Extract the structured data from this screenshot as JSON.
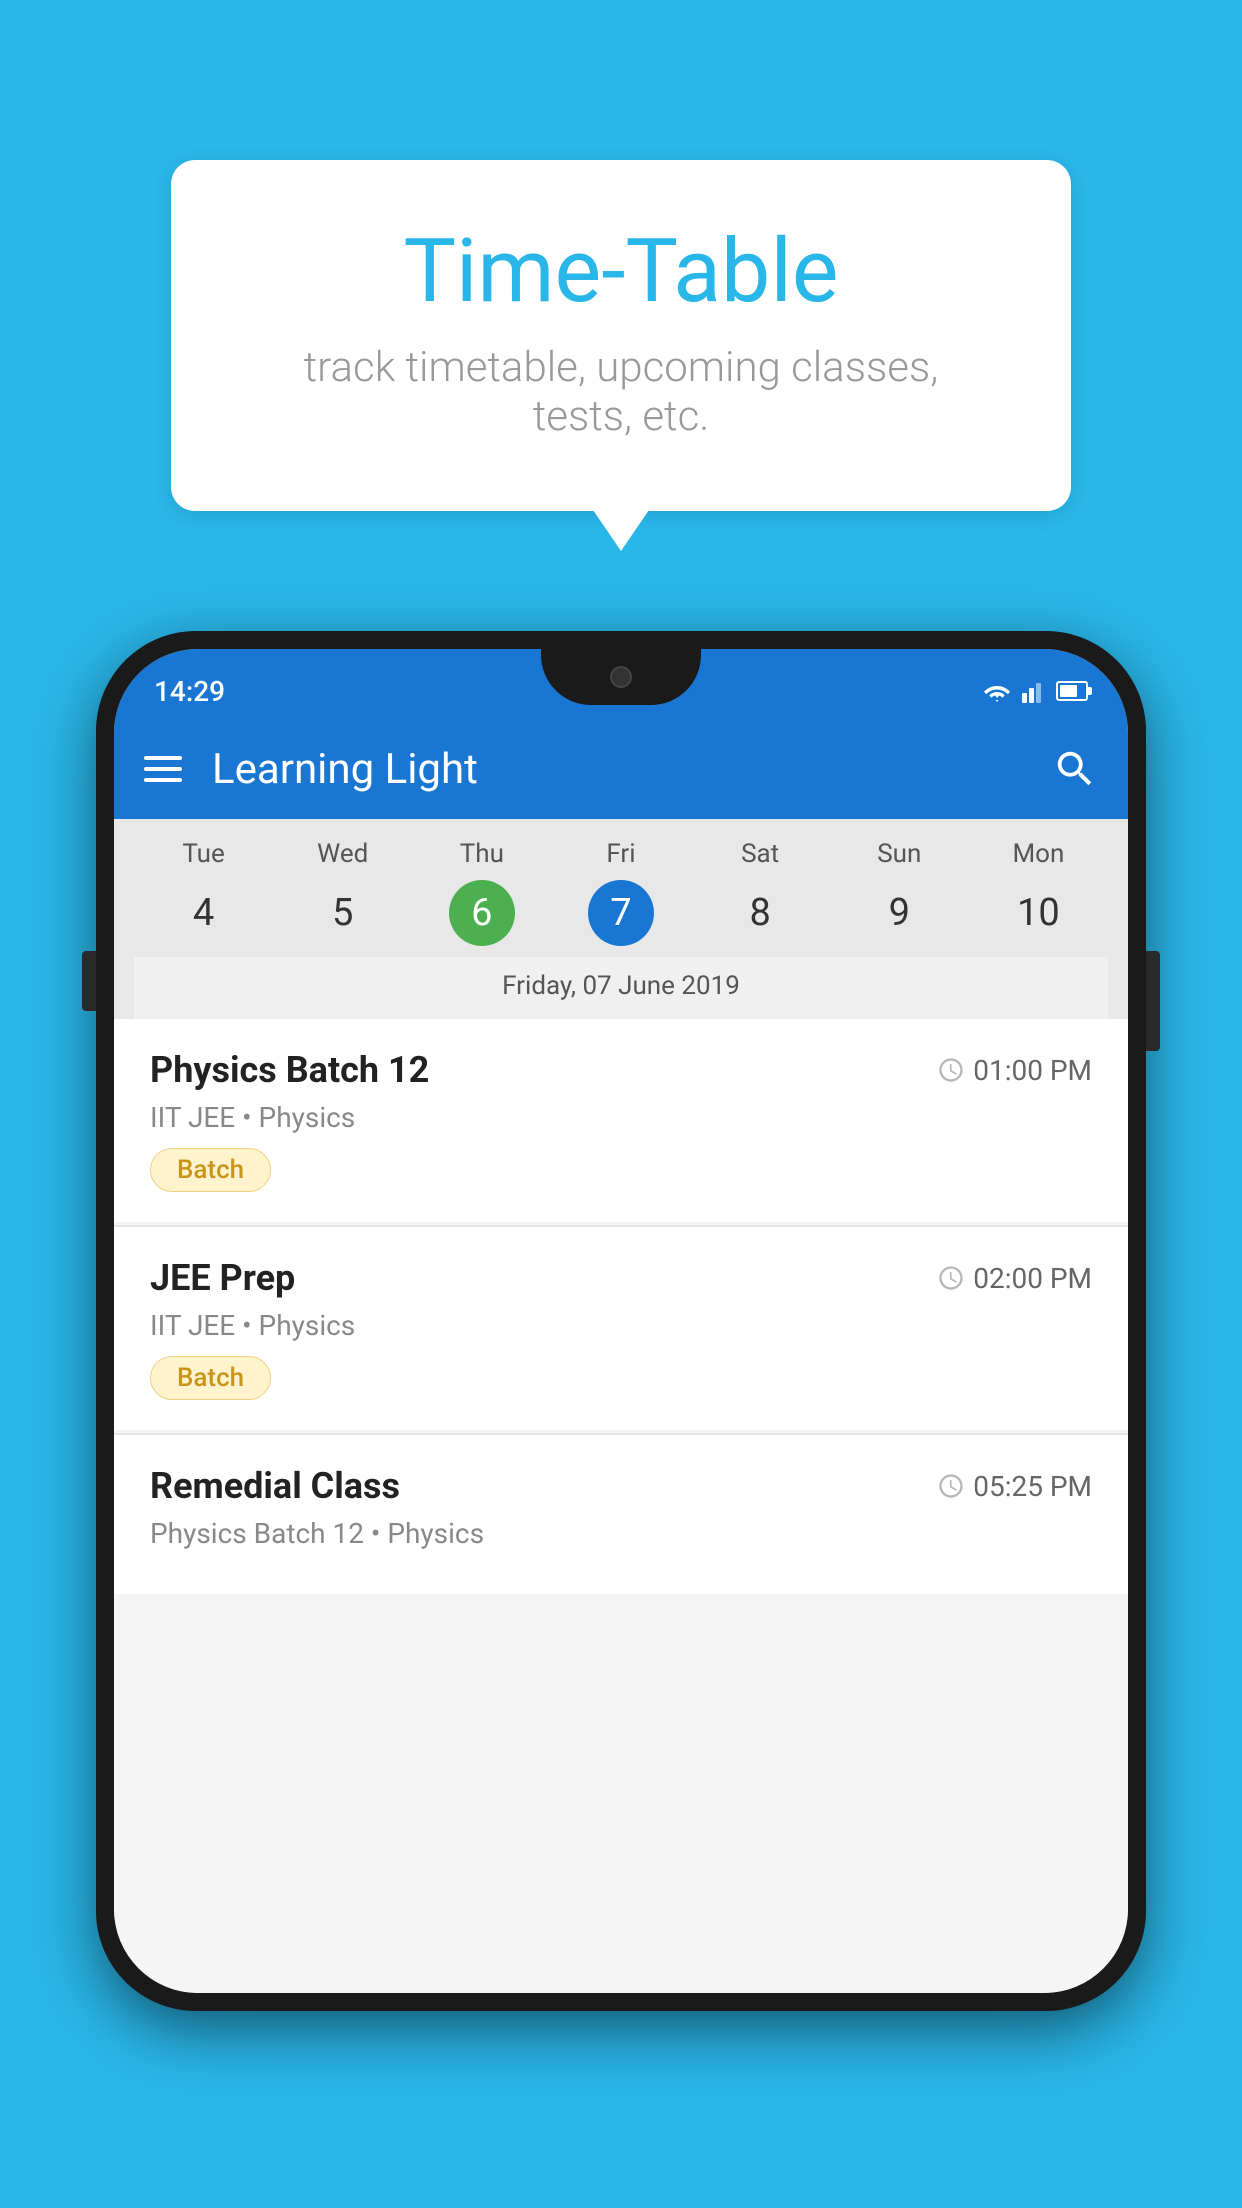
{
  "background_color": "#29B6E8",
  "tooltip": {
    "title": "Time-Table",
    "subtitle": "track timetable, upcoming classes, tests, etc."
  },
  "phone": {
    "status_bar": {
      "time": "14:29",
      "wifi": true,
      "signal": true,
      "battery": true
    },
    "app_bar": {
      "title": "Learning Light",
      "search_label": "Search"
    },
    "calendar": {
      "days": [
        {
          "label": "Tue",
          "number": "4"
        },
        {
          "label": "Wed",
          "number": "5"
        },
        {
          "label": "Thu",
          "number": "6",
          "state": "today"
        },
        {
          "label": "Fri",
          "number": "7",
          "state": "selected"
        },
        {
          "label": "Sat",
          "number": "8"
        },
        {
          "label": "Sun",
          "number": "9"
        },
        {
          "label": "Mon",
          "number": "10"
        }
      ],
      "selected_date": "Friday, 07 June 2019"
    },
    "schedule": [
      {
        "name": "Physics Batch 12",
        "time": "01:00 PM",
        "subtitle": "IIT JEE • Physics",
        "badge": "Batch"
      },
      {
        "name": "JEE Prep",
        "time": "02:00 PM",
        "subtitle": "IIT JEE • Physics",
        "badge": "Batch"
      },
      {
        "name": "Remedial Class",
        "time": "05:25 PM",
        "subtitle": "Physics Batch 12 • Physics",
        "badge": null
      }
    ]
  }
}
